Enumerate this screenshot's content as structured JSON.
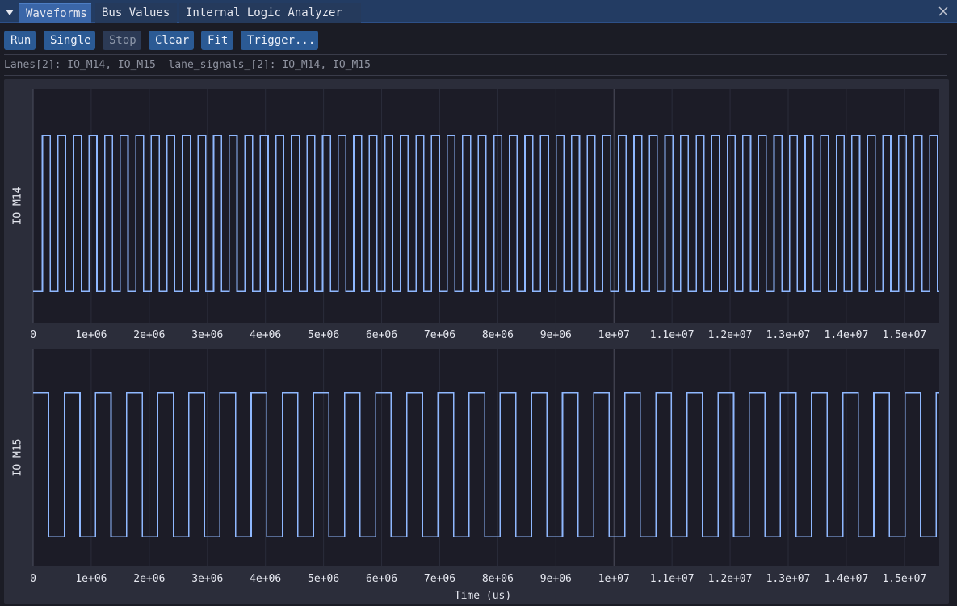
{
  "tabs": [
    {
      "label": "Waveforms",
      "active": true
    },
    {
      "label": "Bus Values",
      "active": false
    },
    {
      "label": "Internal Logic Analyzer",
      "active": false
    }
  ],
  "toolbar": {
    "run": "Run",
    "single": "Single",
    "stop": "Stop",
    "clear": "Clear",
    "fit": "Fit",
    "trigger": "Trigger..."
  },
  "info_line": "Lanes[2]: IO_M14, IO_M15  lane_signals_[2]: IO_M14, IO_M15",
  "colors": {
    "trace": "#8fb8ff",
    "plot_bg": "#1c1c27",
    "frame_bg": "#2b2d3a",
    "accent": "#2b5a94",
    "tab_active": "#3a66a8"
  },
  "icons": {
    "collapse": "triangle-down-icon",
    "close": "close-icon"
  },
  "chart_data": [
    {
      "type": "line",
      "step": true,
      "series": [
        {
          "name": "IO_M14"
        }
      ],
      "ylabel": "IO_M14",
      "xlabel": "",
      "xlim": [
        0,
        15600000
      ],
      "ylim": [
        -0.2,
        1.3
      ],
      "x_ticks": [
        0,
        1000000,
        2000000,
        3000000,
        4000000,
        5000000,
        6000000,
        7000000,
        8000000,
        9000000,
        10000000,
        11000000,
        12000000,
        13000000,
        14000000,
        15000000
      ],
      "x_tick_labels": [
        "0",
        "1e+06",
        "2e+06",
        "3e+06",
        "4e+06",
        "5e+06",
        "6e+06",
        "7e+06",
        "8e+06",
        "9e+06",
        "1e+07",
        "1.1e+07",
        "1.2e+07",
        "1.3e+07",
        "1.4e+07",
        "1.5e+07"
      ],
      "signal": {
        "start_level": 0,
        "first_edge_us": 160000,
        "half_period_us": 134000,
        "high": 1,
        "low": 0
      },
      "cursor_x": 10000000,
      "grid": true
    },
    {
      "type": "line",
      "step": true,
      "series": [
        {
          "name": "IO_M15"
        }
      ],
      "ylabel": "IO_M15",
      "xlabel": "Time (us)",
      "xlim": [
        0,
        15600000
      ],
      "ylim": [
        -0.2,
        1.3
      ],
      "x_ticks": [
        0,
        1000000,
        2000000,
        3000000,
        4000000,
        5000000,
        6000000,
        7000000,
        8000000,
        9000000,
        10000000,
        11000000,
        12000000,
        13000000,
        14000000,
        15000000
      ],
      "x_tick_labels": [
        "0",
        "1e+06",
        "2e+06",
        "3e+06",
        "4e+06",
        "5e+06",
        "6e+06",
        "7e+06",
        "8e+06",
        "9e+06",
        "1e+07",
        "1.1e+07",
        "1.2e+07",
        "1.3e+07",
        "1.4e+07",
        "1.5e+07"
      ],
      "signal": {
        "start_level": 1,
        "first_edge_us": 270000,
        "half_period_us": 268000,
        "high": 1,
        "low": 0
      },
      "cursor_x": 10000000,
      "grid": true
    }
  ]
}
